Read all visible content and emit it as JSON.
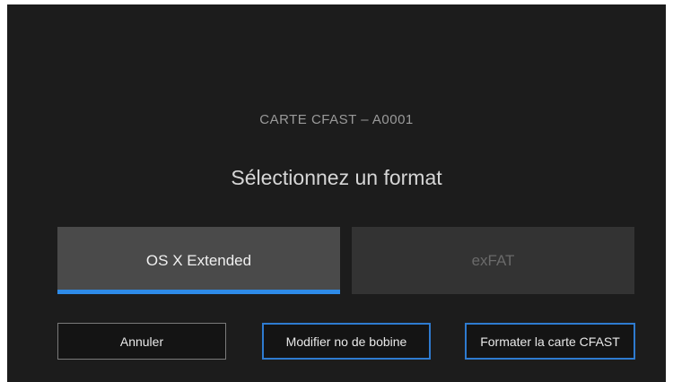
{
  "dialog": {
    "card_label": "CARTE CFAST – A0001",
    "heading": "Sélectionnez un format"
  },
  "formats": {
    "selected": "OS X Extended",
    "options": [
      {
        "label": "OS X Extended",
        "selected": true
      },
      {
        "label": "exFAT",
        "selected": false
      }
    ]
  },
  "buttons": {
    "cancel": "Annuler",
    "reel": "Modifier no de bobine",
    "format": "Formater la carte CFAST"
  },
  "colors": {
    "background": "#1c1c1c",
    "accent": "#2e8be8",
    "selected_option": "#4a4a4a",
    "unselected_option": "#333333"
  }
}
